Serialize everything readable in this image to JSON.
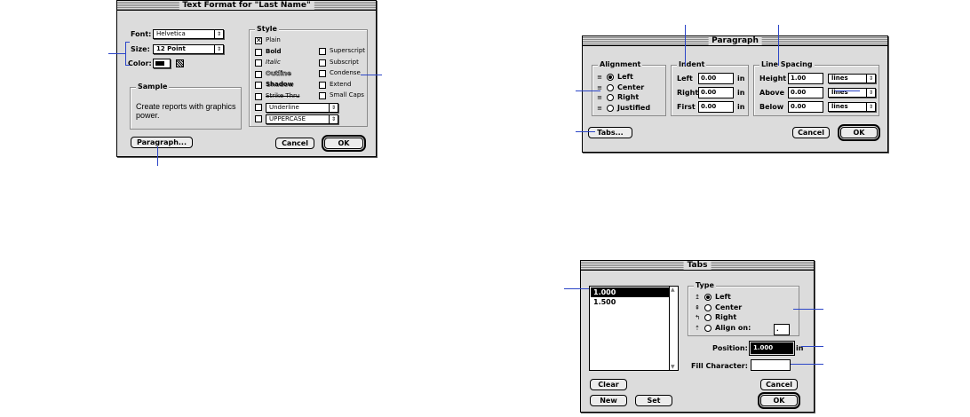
{
  "text_format": {
    "title": "Text Format for \"Last Name\"",
    "font_label": "Font:",
    "font_value": "Helvetica",
    "size_label": "Size:",
    "size_value": "12 Point",
    "color_label": "Color:",
    "sample_title": "Sample",
    "sample_text": "Create reports with graphics power.",
    "style_title": "Style",
    "styles_left": [
      {
        "label": "Plain",
        "checked": true
      },
      {
        "label": "Bold",
        "checked": false
      },
      {
        "label": "Italic",
        "checked": false
      },
      {
        "label": "Outline",
        "checked": false
      },
      {
        "label": "Shadow",
        "checked": false
      },
      {
        "label": "Strike Thru",
        "checked": false
      }
    ],
    "styles_right": [
      {
        "label": "Superscript",
        "checked": false
      },
      {
        "label": "Subscript",
        "checked": false
      },
      {
        "label": "Condense",
        "checked": false
      },
      {
        "label": "Extend",
        "checked": false
      },
      {
        "label": "Small Caps",
        "checked": false
      }
    ],
    "underline_value": "Underline",
    "case_value": "UPPERCASE",
    "paragraph_button": "Paragraph...",
    "cancel_button": "Cancel",
    "ok_button": "OK"
  },
  "paragraph": {
    "title": "Paragraph",
    "alignment_title": "Alignment",
    "alignments": [
      {
        "label": "Left",
        "selected": true
      },
      {
        "label": "Center",
        "selected": false
      },
      {
        "label": "Right",
        "selected": false
      },
      {
        "label": "Justified",
        "selected": false
      }
    ],
    "indent_title": "Indent",
    "indents": [
      {
        "label": "Left",
        "value": "0.00",
        "unit": "in"
      },
      {
        "label": "Right",
        "value": "0.00",
        "unit": "in"
      },
      {
        "label": "First",
        "value": "0.00",
        "unit": "in"
      }
    ],
    "spacing_title": "Line Spacing",
    "spacings": [
      {
        "label": "Height",
        "value": "1.00",
        "unit": "lines"
      },
      {
        "label": "Above",
        "value": "0.00",
        "unit": "lines"
      },
      {
        "label": "Below",
        "value": "0.00",
        "unit": "lines"
      }
    ],
    "tabs_button": "Tabs...",
    "cancel_button": "Cancel",
    "ok_button": "OK"
  },
  "tabs": {
    "title": "Tabs",
    "list": [
      "1.000",
      "1.500"
    ],
    "type_title": "Type",
    "types": [
      {
        "label": "Left",
        "selected": true
      },
      {
        "label": "Center",
        "selected": false
      },
      {
        "label": "Right",
        "selected": false
      },
      {
        "label": "Align on:",
        "selected": false
      }
    ],
    "align_char": ".",
    "position_label": "Position:",
    "position_value": "1.000",
    "position_unit": "in",
    "fill_label": "Fill Character:",
    "fill_value": "",
    "clear_button": "Clear",
    "new_button": "New",
    "set_button": "Set",
    "cancel_button": "Cancel",
    "ok_button": "OK"
  },
  "colors": {
    "callout": "#2b45c8",
    "dialog_bg": "#dcdcdc"
  }
}
